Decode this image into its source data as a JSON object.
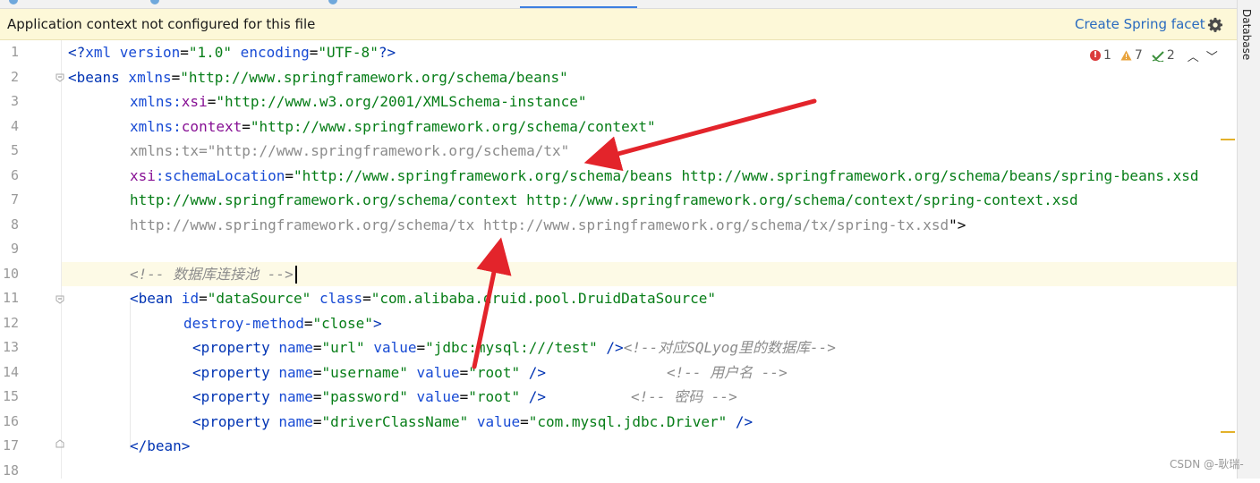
{
  "banner": {
    "message": "Application context not configured for this file",
    "action_label": "Create Spring facet",
    "settings_icon": "gear-icon"
  },
  "inspections": {
    "errors": "1",
    "warnings": "7",
    "typos": "2"
  },
  "side_panel": {
    "label": "Database"
  },
  "watermark": "CSDN @-耿瑞-",
  "line_numbers": [
    "1",
    "2",
    "3",
    "4",
    "5",
    "6",
    "7",
    "8",
    "9",
    "10",
    "11",
    "12",
    "13",
    "14",
    "15",
    "16",
    "17",
    "18"
  ],
  "code": {
    "l1": {
      "a": "<?",
      "b": "xml version",
      "c": "=",
      "d": "\"1.0\"",
      "e": " encoding",
      "f": "=",
      "g": "\"UTF-8\"",
      "h": "?>"
    },
    "l2": {
      "a": "<beans",
      "b": " xmlns",
      "c": "=",
      "d": "\"http://www.springframework.org/schema/beans\""
    },
    "l3": {
      "a": "xmlns:",
      "b": "xsi",
      "c": "=",
      "d": "\"http://www.w3.org/2001/XMLSchema-instance\""
    },
    "l4": {
      "a": "xmlns:",
      "b": "context",
      "c": "=",
      "d": "\"http://www.springframework.org/schema/context\""
    },
    "l5": {
      "a": "xmlns:tx=\"http://www.springframework.org/schema/tx\""
    },
    "l6": {
      "a": "xsi",
      "b": ":schemaLocation",
      "c": "=",
      "d": "\"http://www.springframework.org/schema/beans http://www.springframework.org/schema/beans/spring-beans.xsd"
    },
    "l7": {
      "a": "http://www.springframework.org/schema/context http://www.springframework.org/schema/context/spring-context.xsd"
    },
    "l8": {
      "a": "http://www.springframework.org/schema/tx http://www.springframework.org/schema/tx/spring-tx.xsd",
      "b": "\">"
    },
    "l10": {
      "a": "<!-- 数据库连接池 -->"
    },
    "l11": {
      "a": "<bean",
      "b": " id",
      "c": "=",
      "d": "\"dataSource\"",
      "e": " class",
      "f": "=",
      "g": "\"com.alibaba.druid.pool.DruidDataSource\""
    },
    "l12": {
      "a": "destroy-method",
      "b": "=",
      "c": "\"close\"",
      "d": ">"
    },
    "l13": {
      "a": "<property",
      "b": " name",
      "c": "=",
      "d": "\"url\"",
      "e": " value",
      "f": "=",
      "g": "\"jdbc:mysql:///test\"",
      "h": " />",
      "i": "<!--对应SQLyog里的数据库-->"
    },
    "l14": {
      "a": "<property",
      "b": " name",
      "c": "=",
      "d": "\"username\"",
      "e": " value",
      "f": "=",
      "g": "\"root\"",
      "h": " />",
      "i": "<!-- 用户名 -->"
    },
    "l15": {
      "a": "<property",
      "b": " name",
      "c": "=",
      "d": "\"password\"",
      "e": " value",
      "f": "=",
      "g": "\"root\"",
      "h": " />",
      "i": "<!-- 密码 -->"
    },
    "l16": {
      "a": "<property",
      "b": " name",
      "c": "=",
      "d": "\"driverClassName\"",
      "e": " value",
      "f": "=",
      "g": "\"com.mysql.jdbc.Driver\"",
      "h": " />"
    },
    "l17": {
      "a": "</bean",
      "b": ">"
    }
  },
  "colors": {
    "tag": "#0033b3",
    "attribute": "#174ad4",
    "namespace": "#871094",
    "value": "#067d17",
    "comment": "#8c8c8c",
    "annotation_arrow": "#e3242b",
    "banner_bg": "#fdf8d8"
  }
}
